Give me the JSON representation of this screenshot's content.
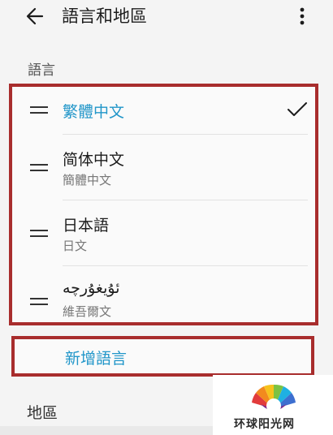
{
  "header": {
    "title": "語言和地區"
  },
  "language_section": {
    "label": "語言"
  },
  "languages": [
    {
      "name": "繁體中文"
    },
    {
      "name": "简体中文",
      "native": "簡體中文"
    },
    {
      "name": "日本語",
      "native": "日文"
    },
    {
      "name": "ئۇيغۇرچە",
      "native": "維吾爾文"
    }
  ],
  "add_language": {
    "label": "新增語言"
  },
  "region_section": {
    "label": "地區"
  },
  "watermark": {
    "text": "环球阳光网"
  },
  "colors": {
    "accent": "#2196c9",
    "highlight_border": "#a82d2d"
  }
}
